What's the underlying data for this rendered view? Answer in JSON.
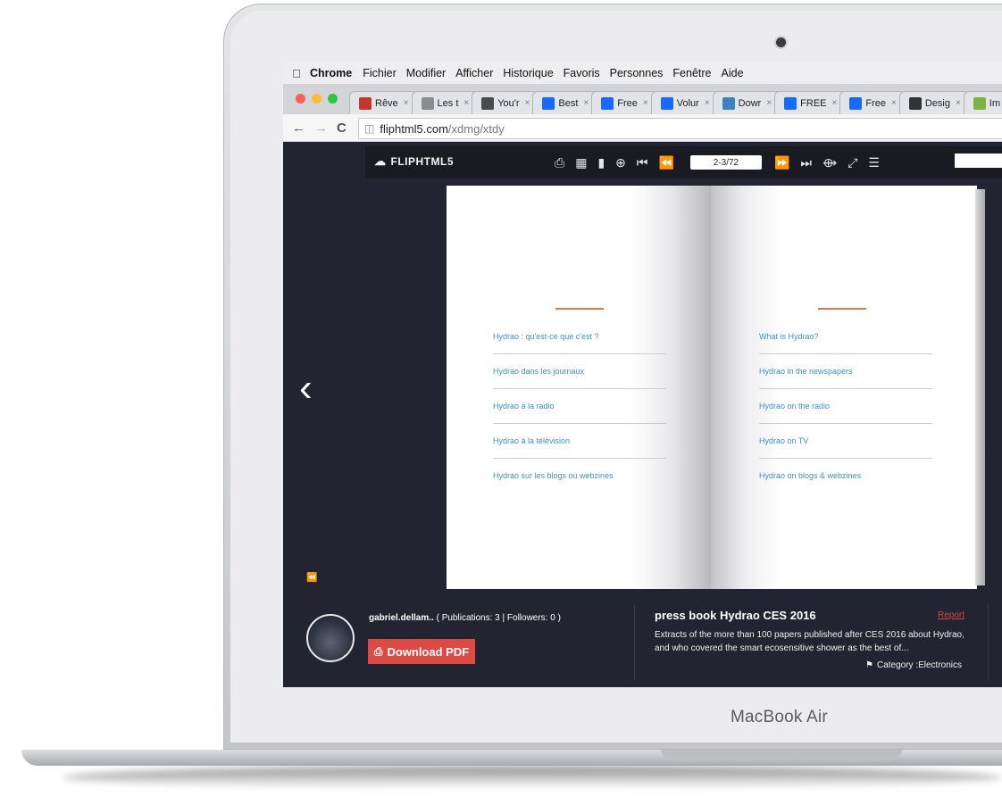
{
  "device": {
    "label": "MacBook Air"
  },
  "menubar": {
    "app": "Chrome",
    "items": [
      "Fichier",
      "Modifier",
      "Afficher",
      "Historique",
      "Favoris",
      "Personnes",
      "Fenêtre",
      "Aide"
    ]
  },
  "tabs": [
    {
      "label": "Rêve",
      "icon": "document-icon",
      "color": "#c0392b"
    },
    {
      "label": "Les t",
      "icon": "page-icon",
      "color": "#8c8c8c"
    },
    {
      "label": "You'r",
      "icon": "google-icon",
      "color": "#4a4a4a"
    },
    {
      "label": "Best",
      "icon": "behance-icon",
      "color": "#1769ff"
    },
    {
      "label": "Free",
      "icon": "behance-icon",
      "color": "#1769ff"
    },
    {
      "label": "Volur",
      "icon": "behance-icon",
      "color": "#1769ff"
    },
    {
      "label": "Dowr",
      "icon": "upload-icon",
      "color": "#3b82c4"
    },
    {
      "label": "FREE",
      "icon": "behance-icon",
      "color": "#1769ff"
    },
    {
      "label": "Free",
      "icon": "behance-icon",
      "color": "#1769ff"
    },
    {
      "label": "Desig",
      "icon": "q-icon",
      "color": "#333333"
    },
    {
      "label": "Im",
      "icon": "s-icon",
      "color": "#7cb342"
    }
  ],
  "address": {
    "host": "fliphtml5.com",
    "path": "/xdmg/xtdy"
  },
  "viewer": {
    "logo": "FLIPHTML5",
    "page_indicator": "2-3/72"
  },
  "book": {
    "left_items": [
      "Hydrao : qu'est-ce que c'est ?",
      "Hydrao dans les journaux",
      "Hydrao à la radio",
      "Hydrao à la télévision",
      "Hydrao sur les blogs ou webzines"
    ],
    "right_items": [
      "What is Hydrao?",
      "Hydrao in the newspapers",
      "Hydrao on the radio",
      "Hydrao on TV",
      "Hydrao on blogs & webzines"
    ],
    "accent_color": "#e2793f",
    "link_color": "#3a94c8"
  },
  "publisher": {
    "name": "gabriel.dellam..",
    "stats": "( Publications: 3 | Followers: 0 )",
    "download_label": "Download PDF"
  },
  "publication": {
    "title": "press book Hydrao CES 2016",
    "report_label": "Report",
    "description": "Extracts of the more than 100 papers published after CES 2016 about Hydrao, and who covered the smart ecosensitive shower as the best of...",
    "category": "Category :Electronics"
  }
}
